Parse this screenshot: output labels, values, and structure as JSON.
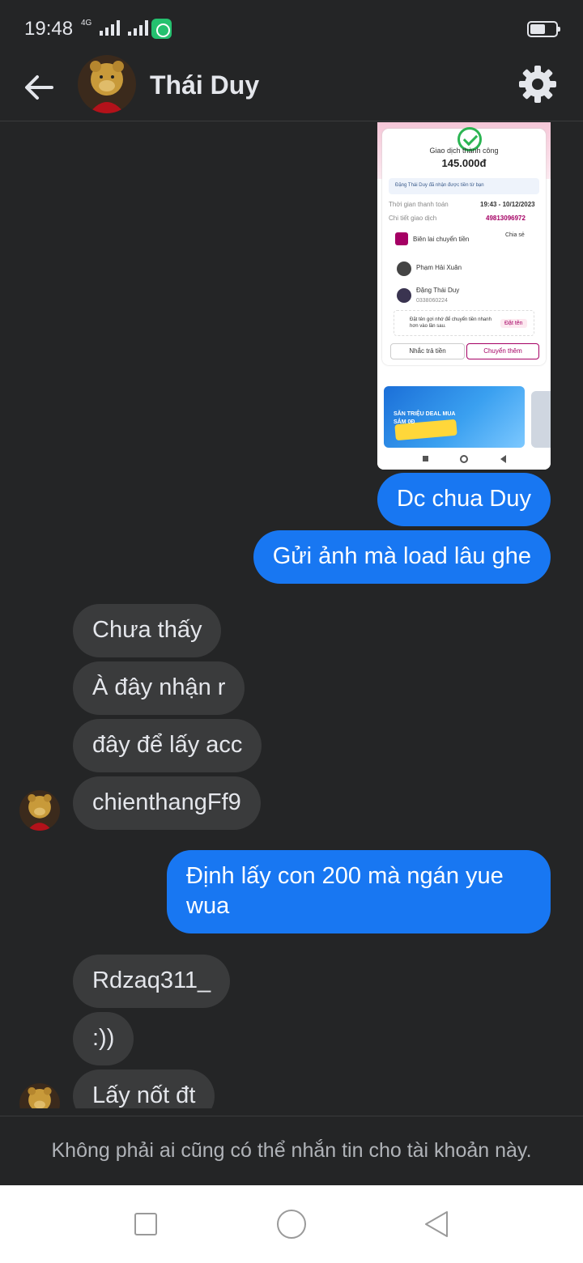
{
  "status_bar": {
    "time": "19:48",
    "network": "4G",
    "battery_level": 0.45
  },
  "header": {
    "contact_name": "Thái Duy"
  },
  "shared_screenshot": {
    "title": "Giao dịch thành công",
    "amount": "145.000đ",
    "notice": "Đặng Thái Duy đã nhận được tiền từ bạn",
    "time_label": "Thời gian thanh toán",
    "time_value": "19:43 - 10/12/2023",
    "detail_label": "Chi tiết giao dịch",
    "detail_value": "49813096972",
    "receipt_label": "Biên lai chuyển tiền",
    "share_label": "Chia sẻ",
    "brand": "mo mo",
    "sender_name": "Phạm Hải Xuân",
    "receiver_name": "Đặng Thái Duy",
    "receiver_phone": "0338060224",
    "reminder_text": "Đặt tên gợi nhớ để chuyển tiền nhanh hơn vào lần sau.",
    "set_name_button": "Đặt tên",
    "remind_button": "Nhắc trả tiền",
    "transfer_more_button": "Chuyển thêm",
    "banner_text": "SĂN TRIỆU DEAL MUA SẮM 0Đ"
  },
  "messages": [
    {
      "direction": "out",
      "text": "Dc chua Duy"
    },
    {
      "direction": "out",
      "text": "Gửi ảnh mà load lâu ghe"
    },
    {
      "direction": "in",
      "text": "Chưa thấy"
    },
    {
      "direction": "in",
      "text": "À đây nhận r"
    },
    {
      "direction": "in",
      "text": "đây để lấy acc"
    },
    {
      "direction": "in",
      "text": "chienthangFf9"
    },
    {
      "direction": "out",
      "text": "Định lấy con 200 mà ngán yue wua"
    },
    {
      "direction": "in",
      "text": "Rdzaq311_"
    },
    {
      "direction": "in",
      "text": ":))"
    },
    {
      "direction": "in",
      "text": "Lấy nốt đt"
    }
  ],
  "msg_out_wrapped": {
    "line1": "Định lấy con 200 mà ngán yue",
    "line2": "wua"
  },
  "footer": {
    "notice": "Không phải ai cũng có thể nhắn tin cho tài khoản này."
  },
  "colors": {
    "background": "#242526",
    "outgoing_bubble": "#1877f2",
    "incoming_bubble": "#3a3b3c",
    "nav_bar": "#ffffff"
  }
}
